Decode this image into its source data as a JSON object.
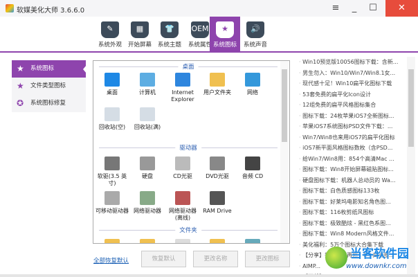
{
  "window": {
    "title": "软媒美化大师 3.6.6.0",
    "menu_icon": "≡",
    "min_icon": "_",
    "max_icon": "☐",
    "close_icon": "✕"
  },
  "tabs": [
    {
      "label": "系统外观",
      "icon": "✎"
    },
    {
      "label": "开始屏幕",
      "icon": "▦"
    },
    {
      "label": "系统主题",
      "icon": "👕"
    },
    {
      "label": "系统属性",
      "icon": "OEM"
    },
    {
      "label": "系统图标",
      "icon": "★",
      "active": true
    },
    {
      "label": "系统声音",
      "icon": "🔊"
    }
  ],
  "sidebar": [
    {
      "label": "系统图标",
      "icon": "★",
      "active": true
    },
    {
      "label": "文件类型图标",
      "icon": "★"
    },
    {
      "label": "系统图标修复",
      "icon": "✪"
    }
  ],
  "sections": [
    {
      "title": "桌面",
      "items": [
        {
          "label": "桌面",
          "color": "#1e88e5"
        },
        {
          "label": "计算机",
          "color": "#5dade2"
        },
        {
          "label": "Internet Explorer",
          "color": "#2e86de"
        },
        {
          "label": "用户文件夹",
          "color": "#f0c050"
        },
        {
          "label": "网络",
          "color": "#3498db"
        },
        {
          "label": "回收站(空)",
          "color": "#d5dde5"
        },
        {
          "label": "回收站(满)",
          "color": "#d5dde5"
        }
      ]
    },
    {
      "title": "驱动器",
      "items": [
        {
          "label": "软驱(3.5 英寸)",
          "color": "#777"
        },
        {
          "label": "硬盘",
          "color": "#999"
        },
        {
          "label": "CD光驱",
          "color": "#bbb"
        },
        {
          "label": "DVD光驱",
          "color": "#888"
        },
        {
          "label": "音频 CD",
          "color": "#444"
        },
        {
          "label": "可移动驱动器",
          "color": "#aaa"
        },
        {
          "label": "网络驱动器",
          "color": "#8a8"
        },
        {
          "label": "网络驱动器(离线)",
          "color": "#b55"
        },
        {
          "label": "RAM Drive",
          "color": "#555"
        }
      ]
    },
    {
      "title": "文件夹",
      "items": [
        {
          "label": "",
          "color": "#f0c050"
        },
        {
          "label": "",
          "color": "#f0c050"
        },
        {
          "label": "",
          "color": "#ddd"
        },
        {
          "label": "",
          "color": "#f0c050"
        },
        {
          "label": "",
          "color": "#6ab"
        }
      ]
    }
  ],
  "bottom": {
    "reset_all": "全部恢复默认",
    "restore": "恢复默认",
    "rename": "更改名称",
    "change_icon": "更改图标"
  },
  "news": [
    "Win10预览版10056图标下载：含新...",
    "男生勿入：Win10/Win7/Win8.1女...",
    "现代感十足！Win10扁平化图标下载",
    "53套免费的扁平化Icon设计",
    "12组免费的扁平风格图标集合",
    "图标下载：24枚苹果iOS7全新图标...",
    "苹果iOS7系统图标PSD文件下载：...",
    "Win7/Win8也来用iOS7的扁平化图标",
    "iOS7新平面风格图标数枚（含PSD...",
    "给Win7/Win8用：854个高清Mac ...",
    "图标下载：Win8开始屏幕磁贴图标...",
    "硬盘图标下载：机器人总动员的 Wa...",
    "图标下载：白色质感图标133枚",
    "图标下载：好莱坞电影知名角色图...",
    "图标下载：116枚剪纸风图标",
    "图标下载：极致酷炫 - 黑红色系图...",
    "图标下载：Win8 Modern风格文件...",
    "美化福利：5万个图标大合集下载",
    "【分享】找图标不再愁：8个高清图...",
    "AIMP...",
    "【下载】..."
  ],
  "watermark": {
    "name": "当客软件园",
    "url": "www.downkr.com"
  }
}
